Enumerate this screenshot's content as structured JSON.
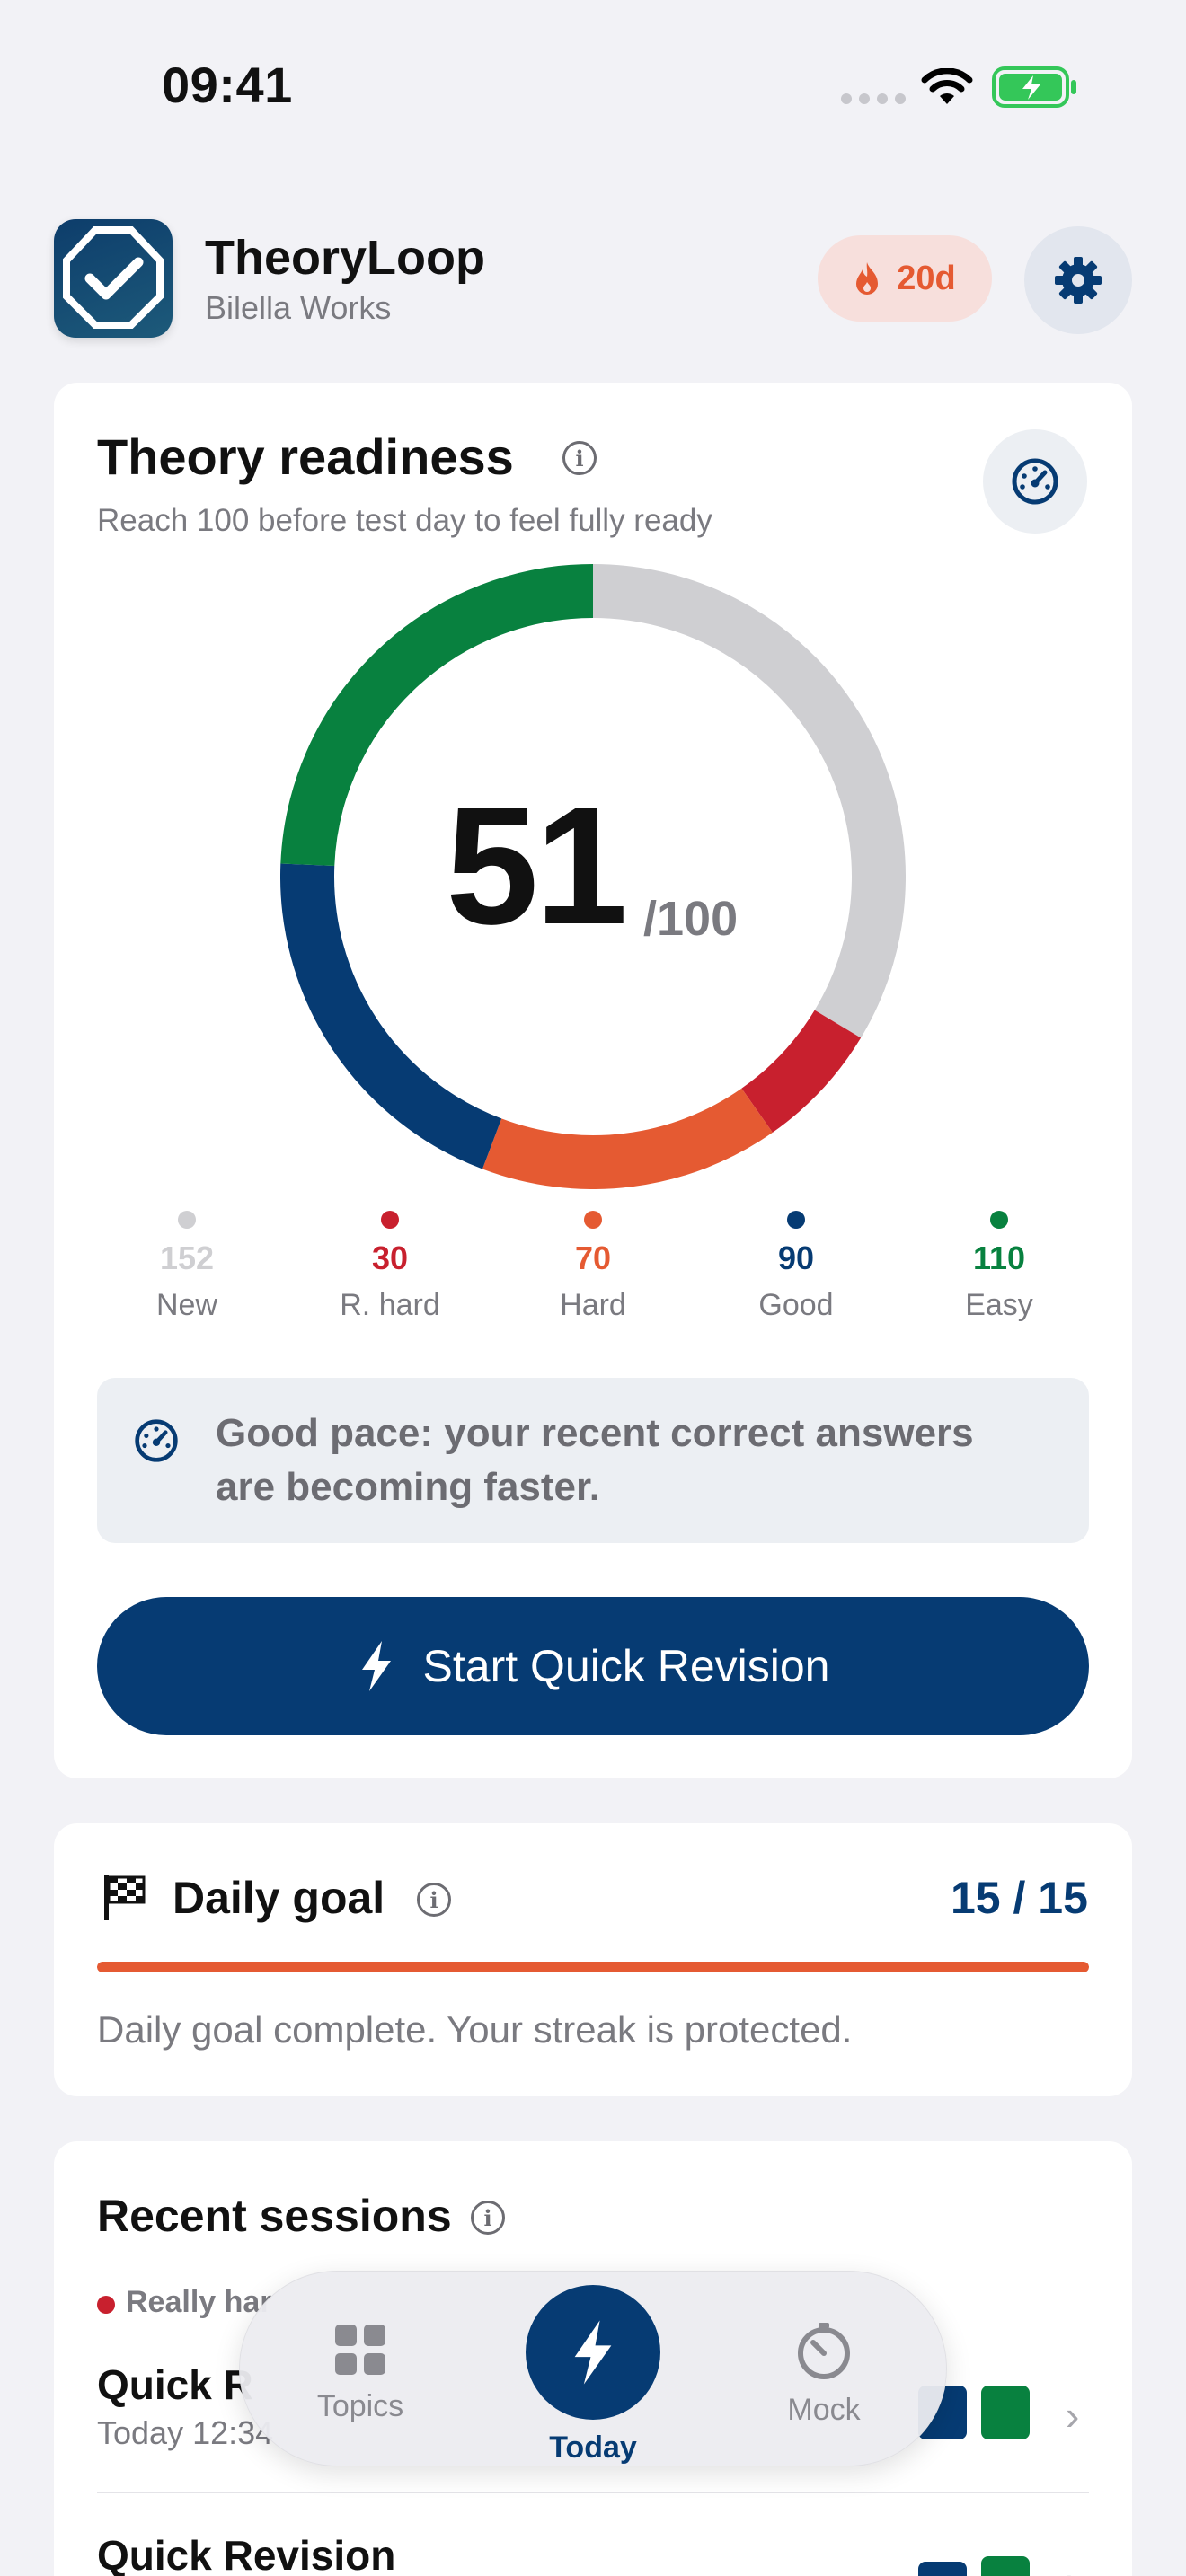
{
  "status_bar": {
    "time": "09:41"
  },
  "header": {
    "app_name": "TheoryLoop",
    "app_subtitle": "Bilella Works",
    "streak": "20d"
  },
  "readiness": {
    "title": "Theory readiness",
    "subtitle": "Reach 100 before test day to feel fully ready",
    "score": "51",
    "score_max": "/100",
    "legend": [
      {
        "count": "152",
        "label": "New",
        "color": "#cfcfd2",
        "count_color": "#cfcfd2"
      },
      {
        "count": "30",
        "label": "R. hard",
        "color": "#c8202e",
        "count_color": "#c8202e"
      },
      {
        "count": "70",
        "label": "Hard",
        "color": "#e55a32",
        "count_color": "#e55a32"
      },
      {
        "count": "90",
        "label": "Good",
        "color": "#063b73",
        "count_color": "#063b73"
      },
      {
        "count": "110",
        "label": "Easy",
        "color": "#08813f",
        "count_color": "#08813f"
      }
    ],
    "pace_message": "Good pace: your recent correct answers are becoming faster.",
    "start_button": "Start Quick Revision"
  },
  "daily_goal": {
    "title": "Daily goal",
    "count": "15 / 15",
    "progress": 1.0,
    "message": "Daily goal complete. Your streak is protected."
  },
  "recent": {
    "title": "Recent sessions",
    "sessions": [
      {
        "tag": "Really har",
        "title": "Quick R",
        "time": "Today 12:34"
      },
      {
        "title": "Quick Revision"
      }
    ]
  },
  "tabs": {
    "topics": "Topics",
    "today": "Today",
    "mock": "Mock"
  },
  "colors": {
    "primary": "#063b73",
    "accent": "#e55a32",
    "green": "#08813f",
    "red": "#c8202e"
  }
}
